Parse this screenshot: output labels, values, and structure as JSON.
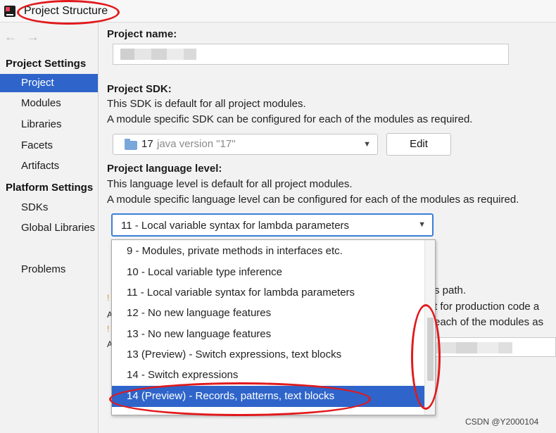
{
  "window": {
    "title": "Project Structure"
  },
  "nav": {
    "back": "←",
    "forward": "→"
  },
  "sidebar": {
    "project_settings": "Project Settings",
    "platform_settings": "Platform Settings",
    "items": [
      "Project",
      "Modules",
      "Libraries",
      "Facets",
      "Artifacts"
    ],
    "platform_items": [
      "SDKs",
      "Global Libraries"
    ],
    "problems": "Problems",
    "selected": "Project"
  },
  "main": {
    "project_name_label": "Project name:",
    "project_sdk_label": "Project SDK:",
    "sdk_desc_1": "This SDK is default for all project modules.",
    "sdk_desc_2": "A module specific SDK can be configured for each of the modules as required.",
    "sdk_name": "17",
    "sdk_version": "java version \"17\"",
    "edit_button": "Edit",
    "lang_level_label": "Project language level:",
    "lang_desc_1": "This language level is default for all project modules.",
    "lang_desc_2": "A module specific language level can be configured for each of the modules as required.",
    "lang_selected": "11 - Local variable syntax for lambda parameters",
    "behind_1": "s path.",
    "behind_2": "t for production code a",
    "behind_3": "each of the modules as"
  },
  "dropdown": {
    "options": [
      "9 - Modules, private methods in interfaces etc.",
      "10 - Local variable type inference",
      "11 - Local variable syntax for lambda parameters",
      "12 - No new language features",
      "13 - No new language features",
      "13 (Preview) - Switch expressions, text blocks",
      "14 - Switch expressions",
      "14 (Preview) - Records, patterns, text blocks"
    ],
    "highlighted": "14 (Preview) - Records, patterns, text blocks"
  },
  "watermark": "CSDN @Y2000104",
  "colors": {
    "selection": "#2f65ca",
    "annotation": "#e1191c",
    "focus_border": "#3b7fd8"
  }
}
